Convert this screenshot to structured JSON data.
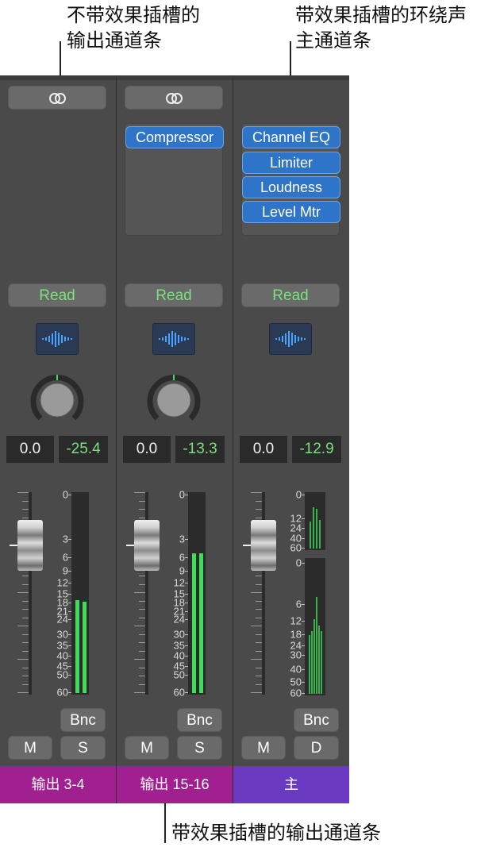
{
  "annotations": {
    "top_left": "不带效果插槽的\n输出通道条",
    "top_right": "带效果插槽的环绕声\n主通道条",
    "bottom": "带效果插槽的输出通道条"
  },
  "colors": {
    "strip_bg": "#4a4a4a",
    "plugin_blue": "#2e74c9",
    "read_green": "#7ddf7d",
    "meter_green": "#3fdd5a",
    "output_name_bg": "#a0208f",
    "master_name_bg": "#6a3ac0"
  },
  "strips": [
    {
      "link_icon": "stereo-link-icon",
      "plugins": [],
      "automation": "Read",
      "wave_icon": "waveform-icon",
      "pan": "0.0",
      "peak": "-25.4",
      "bounce": "Bnc",
      "mute": "M",
      "right_btn": "S",
      "name": "输出 3-4",
      "name_color": "#a0208f",
      "meter_levels": [
        0.46,
        0.45
      ],
      "fader_value": "-10",
      "scale": [
        "0",
        "3",
        "6",
        "9",
        "12",
        "15",
        "18",
        "21",
        "24",
        "30",
        "35",
        "40",
        "45",
        "50",
        "60"
      ]
    },
    {
      "link_icon": "stereo-link-icon",
      "plugins": [
        "Compressor"
      ],
      "automation": "Read",
      "wave_icon": "waveform-icon",
      "pan": "0.0",
      "peak": "-13.3",
      "bounce": "Bnc",
      "mute": "M",
      "right_btn": "S",
      "name": "输出 15-16",
      "name_color": "#a0208f",
      "meter_levels": [
        0.69,
        0.69
      ],
      "fader_value": "-10",
      "scale": [
        "0",
        "3",
        "6",
        "9",
        "12",
        "15",
        "18",
        "21",
        "24",
        "30",
        "35",
        "40",
        "45",
        "50",
        "60"
      ]
    },
    {
      "link_icon": "",
      "plugins": [
        "Channel EQ",
        "Limiter",
        "Loudness",
        "Level Mtr"
      ],
      "automation": "Read",
      "wave_icon": "waveform-icon",
      "pan": "0.0",
      "peak": "-12.9",
      "bounce": "Bnc",
      "mute": "M",
      "right_btn": "D",
      "name": "主",
      "name_color": "#6a3ac0",
      "fader_value": "-10",
      "top_meter_scale": [
        "0",
        "12",
        "24",
        "40",
        "60"
      ],
      "bottom_meter_scale": [
        "0",
        "6",
        "12",
        "18",
        "24",
        "30",
        "40",
        "50",
        "60"
      ]
    }
  ]
}
